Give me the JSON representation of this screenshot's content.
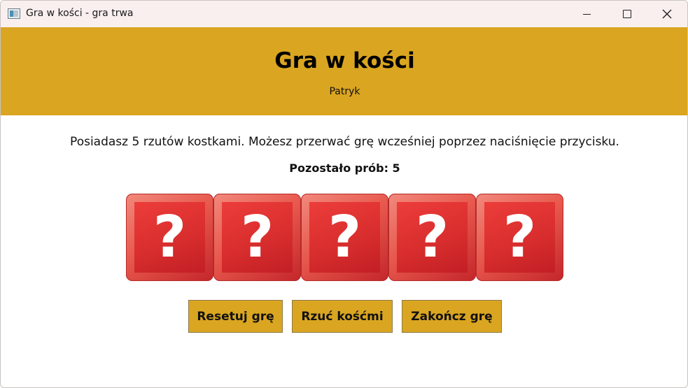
{
  "window": {
    "title": "Gra w kości - gra trwa",
    "controls": {
      "minimize_icon": "minimize-icon",
      "maximize_icon": "maximize-icon",
      "close_glyph": "✕"
    }
  },
  "header": {
    "title": "Gra w kości",
    "player": "Patryk",
    "background_color": "#daa520"
  },
  "main": {
    "info": "Posiadasz 5 rzutów kostkami. Możesz przerwać grę wcześniej poprzez naciśnięcie przycisku.",
    "tries_label": "Pozostało prób: 5"
  },
  "dice": [
    {
      "glyph": "?",
      "state": "unrolled"
    },
    {
      "glyph": "?",
      "state": "unrolled"
    },
    {
      "glyph": "?",
      "state": "unrolled"
    },
    {
      "glyph": "?",
      "state": "unrolled"
    },
    {
      "glyph": "?",
      "state": "unrolled"
    }
  ],
  "buttons": {
    "reset": "Resetuj grę",
    "roll": "Rzuć kośćmi",
    "end": "Zakończ grę",
    "color": "#daa520"
  }
}
